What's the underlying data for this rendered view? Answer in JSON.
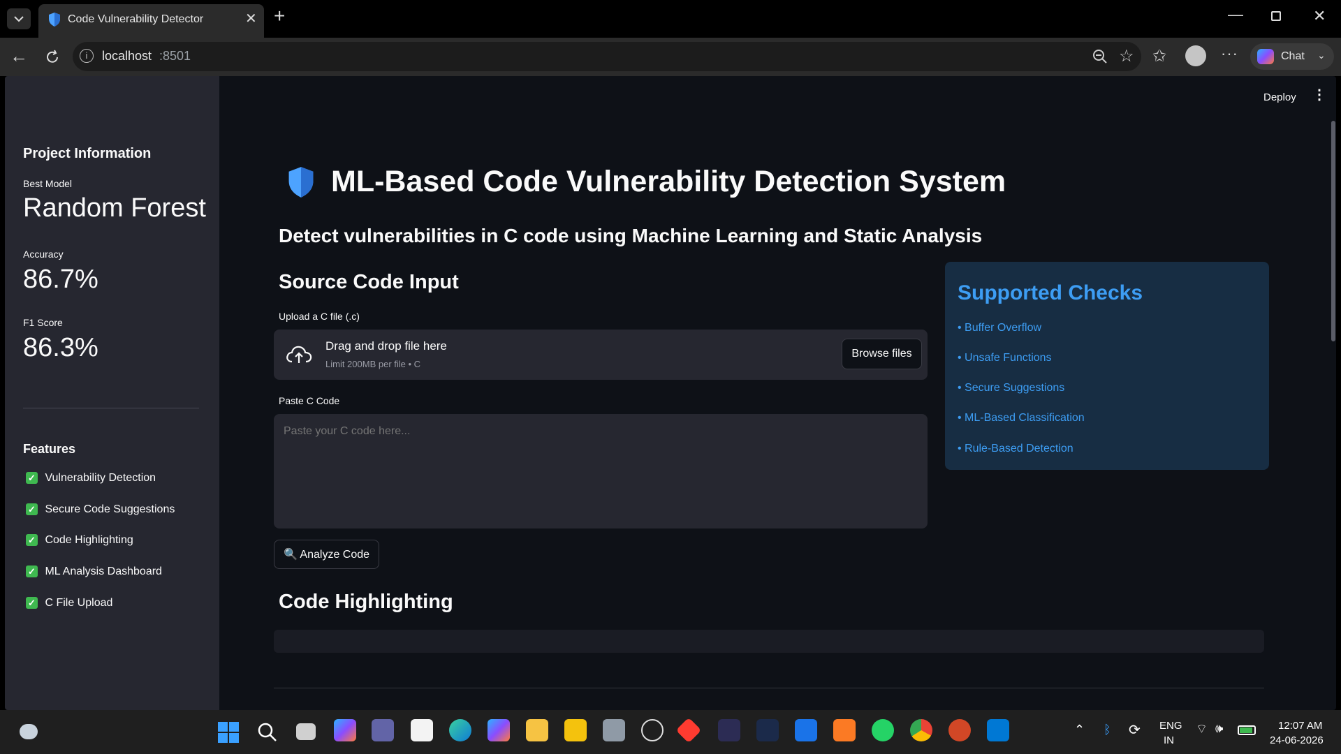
{
  "browser": {
    "tab_title": "Code Vulnerability Detector",
    "url_host": "localhost",
    "url_port": ":8501",
    "copilot_label": "Chat"
  },
  "app": {
    "deploy_label": "Deploy",
    "title": "ML-Based Code Vulnerability Detection System",
    "subtitle": "Detect vulnerabilities in C code using Machine Learning and Static Analysis",
    "source_heading": "Source Code Input",
    "upload_label": "Upload a C file (.c)",
    "drop_text": "Drag and drop file here",
    "drop_limit": "Limit 200MB per file • C",
    "browse_label": "Browse files",
    "paste_label": "Paste C Code",
    "code_placeholder": "Paste your C code here...",
    "analyze_label": "Analyze Code",
    "highlight_heading": "Code Highlighting"
  },
  "sidebar": {
    "project_heading": "Project Information",
    "metrics": [
      {
        "label": "Best Model",
        "value": "Random Forest"
      },
      {
        "label": "Accuracy",
        "value": "86.7%"
      },
      {
        "label": "F1 Score",
        "value": "86.3%"
      }
    ],
    "features_heading": "Features",
    "features": [
      "Vulnerability Detection",
      "Secure Code Suggestions",
      "Code Highlighting",
      "ML Analysis Dashboard",
      "C File Upload"
    ]
  },
  "checks": {
    "title": "Supported Checks",
    "items": [
      "• Buffer Overflow",
      "• Unsafe Functions",
      "• Secure Suggestions",
      "• ML-Based Classification",
      "• Rule-Based Detection"
    ]
  },
  "taskbar": {
    "lang_top": "ENG",
    "lang_bottom": "IN",
    "time": "12:07 AM",
    "date": "24-06-2026"
  },
  "colors": {
    "app_bg": "#0e1117",
    "sidebar_bg": "#262730",
    "accent_blue": "#3d9df3",
    "check_green": "#3fb950"
  }
}
